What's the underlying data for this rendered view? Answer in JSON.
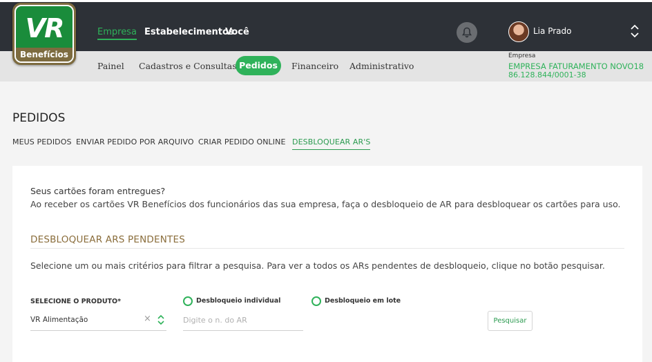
{
  "brand": {
    "logo_text": "VR",
    "logo_subtext": "Benefícios"
  },
  "top_nav": [
    {
      "label": "Empresa",
      "active": true
    },
    {
      "label": "Estabelecimentos",
      "active": false
    },
    {
      "label": "Você",
      "active": false
    }
  ],
  "user": {
    "name": "Lia Prado"
  },
  "sub_nav": [
    {
      "label": "Painel"
    },
    {
      "label": "Cadastros e Consultas"
    },
    {
      "label": "Pedidos",
      "active": true
    },
    {
      "label": "Financeiro"
    },
    {
      "label": "Administrativo"
    }
  ],
  "company": {
    "label": "Empresa",
    "name": "EMPRESA FATURAMENTO NOVO18",
    "cnpj": "86.128.844/0001-38"
  },
  "page": {
    "title": "PEDIDOS"
  },
  "tabs": [
    {
      "label": "MEUS PEDIDOS"
    },
    {
      "label": "ENVIAR PEDIDO POR ARQUIVO"
    },
    {
      "label": "CRIAR PEDIDO ONLINE"
    },
    {
      "label": "DESBLOQUEAR AR'S",
      "active": true
    }
  ],
  "content": {
    "question": "Seus cartões foram entregues?",
    "description": "Ao receber os cartões VR Benefícios dos funcionários das sua empresa, faça o desbloqueio de AR para desbloquear os cartões para uso.",
    "section_title": "DESBLOQUEAR ARS PENDENTES",
    "filter_description": "Selecione um ou mais critérios para filtrar a pesquisa. Para ver a todos os ARs pendentes de desbloqueio, clique no botão pesquisar."
  },
  "form": {
    "product_label": "SELECIONE O PRODUTO*",
    "product_value": "VR Alimentação",
    "radio_individual": "Desbloqueio individual",
    "radio_lote": "Desbloqueio em lote",
    "ar_placeholder": "Digite o n. do AR",
    "search_button": "Pesquisar"
  },
  "colors": {
    "accent": "#2fb25a",
    "header": "#2d3137",
    "gold": "#8a6d3b"
  }
}
